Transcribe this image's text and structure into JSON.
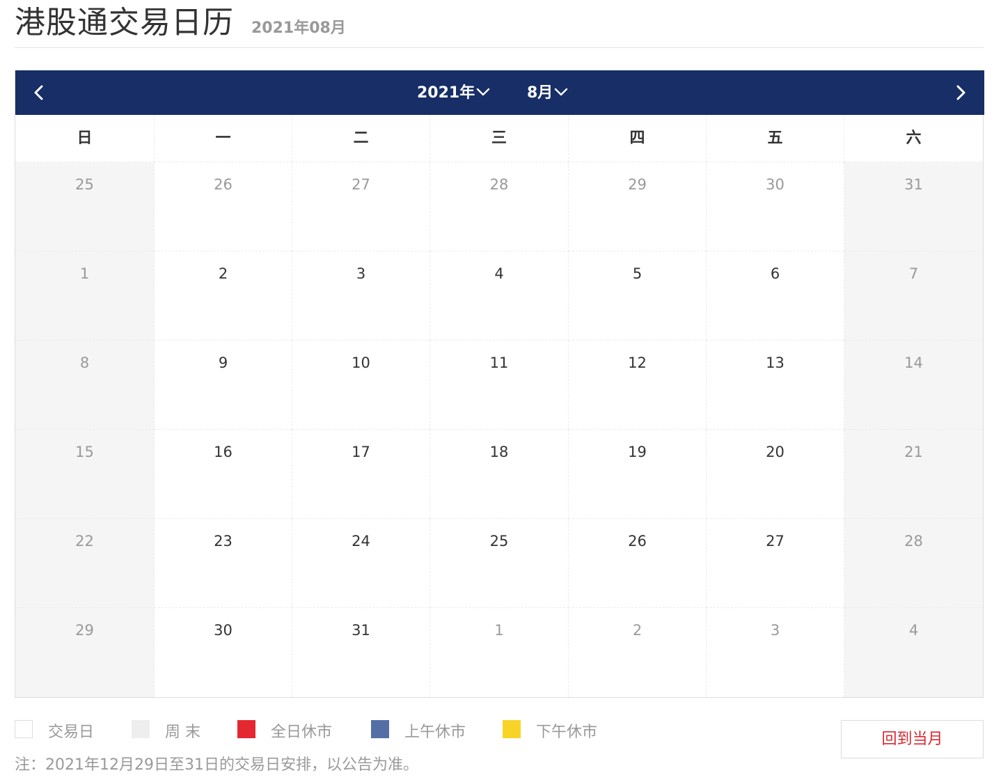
{
  "header": {
    "title": "港股通交易日历",
    "subtitle": "2021年08月"
  },
  "calendar": {
    "nav": {
      "year_label": "2021年",
      "month_label": "8月",
      "prev_icon": "chevron-left-icon",
      "next_icon": "chevron-right-icon",
      "dropdown_icon": "chevron-down-icon"
    },
    "weekdays": [
      "日",
      "一",
      "二",
      "三",
      "四",
      "五",
      "六"
    ],
    "weeks": [
      [
        "25",
        "26",
        "27",
        "28",
        "29",
        "30",
        "31"
      ],
      [
        "1",
        "2",
        "3",
        "4",
        "5",
        "6",
        "7"
      ],
      [
        "8",
        "9",
        "10",
        "11",
        "12",
        "13",
        "14"
      ],
      [
        "15",
        "16",
        "17",
        "18",
        "19",
        "20",
        "21"
      ],
      [
        "22",
        "23",
        "24",
        "25",
        "26",
        "27",
        "28"
      ],
      [
        "29",
        "30",
        "31",
        "1",
        "2",
        "3",
        "4"
      ]
    ],
    "colors": {
      "nav_bg": "#172e66",
      "weekend_bg": "#f5f5f5",
      "muted_text": "#999999"
    }
  },
  "legend": [
    {
      "label": "交易日",
      "color": "#ffffff"
    },
    {
      "label": "周 末",
      "color": "#eeeeee"
    },
    {
      "label": "全日休市",
      "color": "#e3282f"
    },
    {
      "label": "上午休市",
      "color": "#546ea6"
    },
    {
      "label": "下午休市",
      "color": "#f8d427"
    }
  ],
  "actions": {
    "today_button": "回到当月",
    "today_color": "#d9282e"
  },
  "note": "注：2021年12月29日至31日的交易日安排，以公告为准。"
}
